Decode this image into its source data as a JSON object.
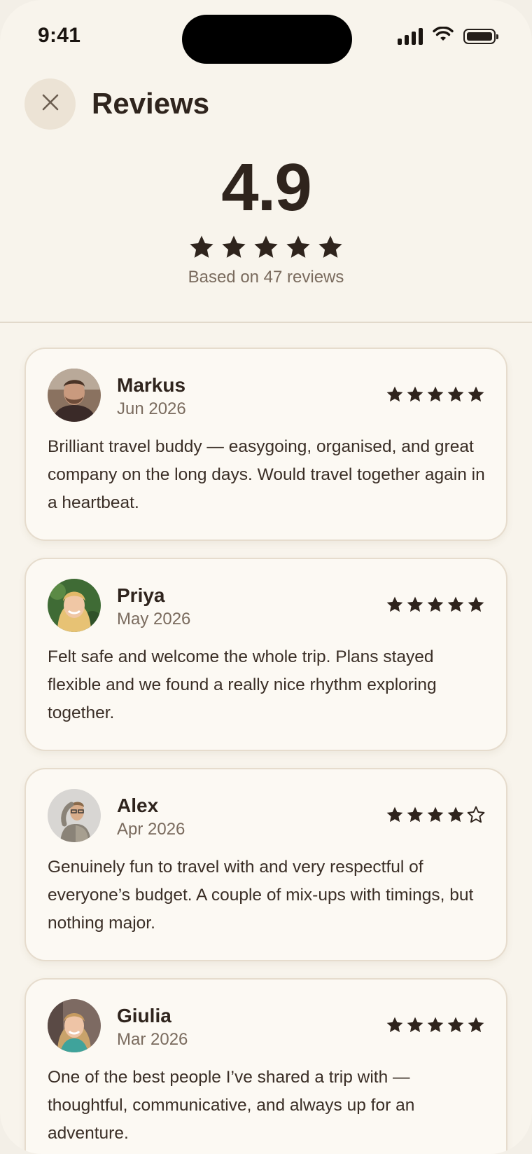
{
  "status_bar": {
    "time": "9:41"
  },
  "header": {
    "title": "Reviews"
  },
  "summary": {
    "average": "4.9",
    "rating": 5,
    "count_text": "Based on 47 reviews"
  },
  "reviews": [
    {
      "name": "Markus",
      "date": "Jun 2026",
      "rating": 5,
      "text": "Brilliant travel buddy — easygoing, organised, and great company on the long days. Would travel together again in a heartbeat."
    },
    {
      "name": "Priya",
      "date": "May 2026",
      "rating": 5,
      "text": "Felt safe and welcome the whole trip. Plans stayed flexible and we found a really nice rhythm exploring together."
    },
    {
      "name": "Alex",
      "date": "Apr 2026",
      "rating": 4,
      "text": "Genuinely fun to travel with and very respectful of everyone’s budget. A couple of mix-ups with timings, but nothing major."
    },
    {
      "name": "Giulia",
      "date": "Mar 2026",
      "rating": 5,
      "text": "One of the best people I’ve shared a trip with — thoughtful, communicative, and always up for an adventure."
    }
  ],
  "colors": {
    "background": "#f8f4ec",
    "card": "#fcf9f3",
    "text": "#2f241d",
    "muted": "#7a6b5e",
    "close_bg": "#ece3d5"
  }
}
